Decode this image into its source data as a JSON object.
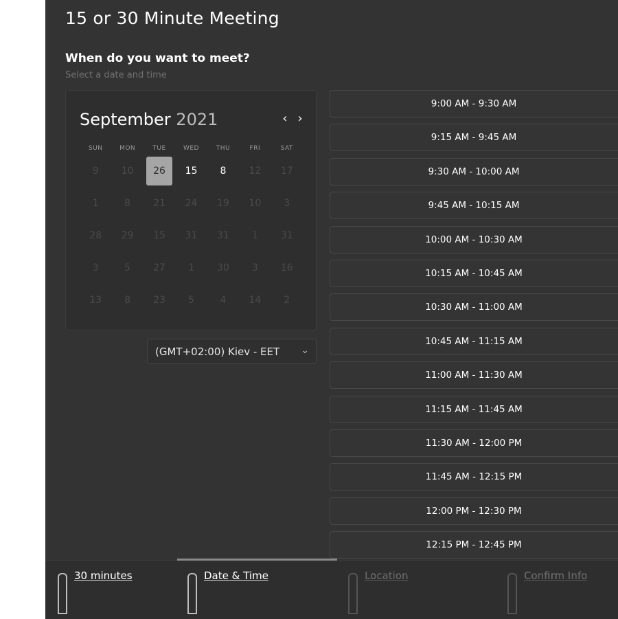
{
  "meeting": {
    "title": "15 or 30 Minute Meeting",
    "question": "When do you want to meet?",
    "subtitle": "Select a date and time"
  },
  "calendar": {
    "month": "September",
    "year": "2021",
    "prev": "‹",
    "next": "›",
    "weekdays": [
      "SUN",
      "MON",
      "TUE",
      "WED",
      "THU",
      "FRI",
      "SAT"
    ],
    "weeks": [
      [
        "9",
        "10",
        "26",
        "15",
        "8",
        "12",
        "17"
      ],
      [
        "1",
        "8",
        "21",
        "24",
        "19",
        "10",
        "3"
      ],
      [
        "28",
        "29",
        "15",
        "31",
        "31",
        "1",
        "31"
      ],
      [
        "3",
        "5",
        "27",
        "1",
        "30",
        "3",
        "16"
      ],
      [
        "13",
        "8",
        "23",
        "5",
        "4",
        "14",
        "2"
      ]
    ],
    "selected_date": "26",
    "available_dates": [
      "15",
      "8"
    ]
  },
  "timezone": {
    "value": "(GMT+02:00) Kiev - EET",
    "chevron": "⌄"
  },
  "time_slots": [
    "9:00 AM - 9:30 AM",
    "9:15 AM - 9:45 AM",
    "9:30 AM - 10:00 AM",
    "9:45 AM - 10:15 AM",
    "10:00 AM - 10:30 AM",
    "10:15 AM - 10:45 AM",
    "10:30 AM - 11:00 AM",
    "10:45 AM - 11:15 AM",
    "11:00 AM - 11:30 AM",
    "11:15 AM - 11:45 AM",
    "11:30 AM - 12:00 PM",
    "11:45 AM - 12:15 PM",
    "12:00 PM - 12:30 PM",
    "12:15 PM - 12:45 PM"
  ],
  "steps": [
    {
      "label": "30 minutes",
      "icon": "clock-icon",
      "state": "done"
    },
    {
      "label": "Date & Time",
      "icon": "calendar-icon",
      "state": "active"
    },
    {
      "label": "Location",
      "icon": "location-icon",
      "state": "pending"
    },
    {
      "label": "Confirm Info",
      "icon": "check-icon",
      "state": "pending"
    }
  ],
  "colors": {
    "background": "#333333",
    "selected_day_bg": "#a5a5a5",
    "slot_border": "#484848"
  }
}
